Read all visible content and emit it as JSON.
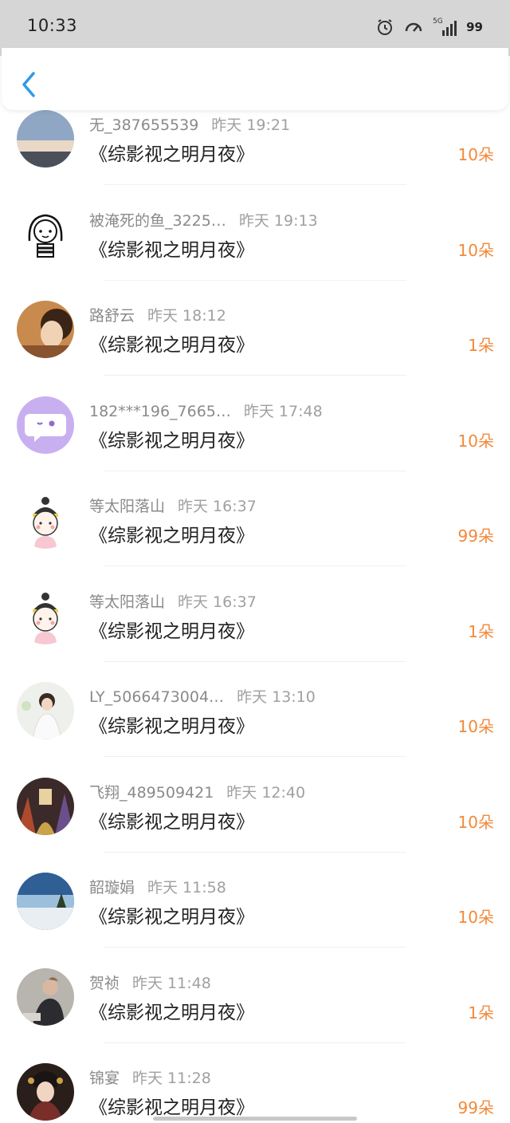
{
  "status_bar": {
    "time": "10:33",
    "battery": "99"
  },
  "header": {
    "back_icon": "chevron-left-icon"
  },
  "colors": {
    "accent": "#2f9be8",
    "count": "#f2893a",
    "status_bar_bg": "#d6d6d6"
  },
  "gifts": [
    {
      "user": "无_387655539",
      "time": "昨天 19:21",
      "work": "《综影视之明月夜》",
      "count": "10朵"
    },
    {
      "user": "被淹死的鱼_3225…",
      "time": "昨天 19:13",
      "work": "《综影视之明月夜》",
      "count": "10朵"
    },
    {
      "user": "路舒云",
      "time": "昨天 18:12",
      "work": "《综影视之明月夜》",
      "count": "1朵"
    },
    {
      "user": "182***196_7665…",
      "time": "昨天 17:48",
      "work": "《综影视之明月夜》",
      "count": "10朵"
    },
    {
      "user": "等太阳落山",
      "time": "昨天 16:37",
      "work": "《综影视之明月夜》",
      "count": "99朵"
    },
    {
      "user": "等太阳落山",
      "time": "昨天 16:37",
      "work": "《综影视之明月夜》",
      "count": "1朵"
    },
    {
      "user": "LY_5066473004…",
      "time": "昨天 13:10",
      "work": "《综影视之明月夜》",
      "count": "10朵"
    },
    {
      "user": "飞翔_489509421",
      "time": "昨天 12:40",
      "work": "《综影视之明月夜》",
      "count": "10朵"
    },
    {
      "user": "韶璇娟",
      "time": "昨天 11:58",
      "work": "《综影视之明月夜》",
      "count": "10朵"
    },
    {
      "user": "贺祯",
      "time": "昨天 11:48",
      "work": "《综影视之明月夜》",
      "count": "1朵"
    },
    {
      "user": "锦宴",
      "time": "昨天 11:28",
      "work": "《综影视之明月夜》",
      "count": "99朵"
    }
  ]
}
